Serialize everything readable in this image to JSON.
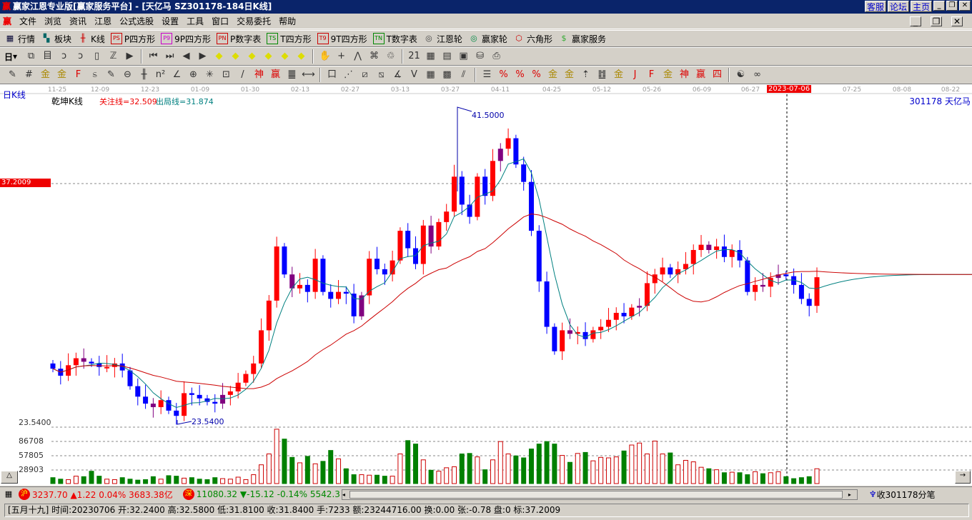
{
  "titlebar": {
    "logo": "赢",
    "title": "赢家江恩专业版[赢家服务平台] - [天亿马  SZ301178-184日K线]",
    "buttons": [
      "客服",
      "论坛",
      "主页"
    ]
  },
  "menu": [
    "文件",
    "浏览",
    "资讯",
    "江恩",
    "公式选股",
    "设置",
    "工具",
    "窗口",
    "交易委托",
    "帮助"
  ],
  "toolbar1": [
    {
      "icon": "table-icon",
      "g": "▦",
      "label": "行情"
    },
    {
      "icon": "blocks-icon",
      "g": "▚",
      "label": "板块"
    },
    {
      "icon": "candle-icon",
      "g": "╫",
      "label": "K线"
    },
    {
      "icon": "ps-icon",
      "g": "PS",
      "label": "P四方形"
    },
    {
      "icon": "p9-icon",
      "g": "P9",
      "label": "9P四方形"
    },
    {
      "icon": "pn-icon",
      "g": "PN",
      "label": "P数字表"
    },
    {
      "icon": "ts-icon",
      "g": "TS",
      "label": "T四方形"
    },
    {
      "icon": "t9-icon",
      "g": "T9",
      "label": "9T四方形"
    },
    {
      "icon": "tn-icon",
      "g": "TN",
      "label": "T数字表"
    },
    {
      "icon": "wheel-icon",
      "g": "◎",
      "label": "江恩轮"
    },
    {
      "icon": "big-wheel-icon",
      "g": "◎",
      "label": "赢家轮"
    },
    {
      "icon": "hexagon-icon",
      "g": "⬡",
      "label": "六角形"
    },
    {
      "icon": "dollar-icon",
      "g": "$",
      "label": "赢家服务"
    }
  ],
  "toolbar2": {
    "period": "日",
    "icons": [
      [
        "draw-icon",
        "⧉"
      ],
      [
        "notes-icon",
        "目"
      ],
      [
        "step3-icon",
        "ↄ"
      ],
      [
        "step9-icon",
        "ↄ"
      ],
      [
        "candle-type-icon",
        "▯"
      ],
      [
        "formula-icon",
        "ℤ"
      ],
      [
        "flag-icon",
        "▶"
      ],
      [
        "first-icon",
        "⏮"
      ],
      [
        "last-icon",
        "⏭"
      ],
      [
        "left-icon",
        "◀"
      ],
      [
        "right-icon",
        "▶"
      ],
      [
        "arrow-left-icon",
        "◆"
      ],
      [
        "arrow-right-icon",
        "◆"
      ],
      [
        "zoom-h-icon",
        "◆"
      ],
      [
        "zoom-in-icon",
        "◆"
      ],
      [
        "zoom-out-icon",
        "◆"
      ],
      [
        "zoom-v-icon",
        "◆"
      ],
      [
        "hand-icon",
        "✋"
      ],
      [
        "cross-icon",
        "+"
      ],
      [
        "line-icon",
        "⋀"
      ],
      [
        "pattern-icon",
        "⌘"
      ],
      [
        "recycle-icon",
        "♲"
      ],
      [
        "calendar-icon",
        "21"
      ],
      [
        "calculator-icon",
        "▦"
      ],
      [
        "doc-icon",
        "▤"
      ],
      [
        "save-icon",
        "▣"
      ],
      [
        "network-icon",
        "⛁"
      ],
      [
        "terminal-icon",
        "⎙"
      ]
    ]
  },
  "toolbar3": {
    "icons": [
      [
        "pen-icon",
        "✎"
      ],
      [
        "grid-icon",
        "#"
      ],
      [
        "gold1-icon",
        "金"
      ],
      [
        "gold2-icon",
        "金"
      ],
      [
        "f-icon",
        "F"
      ],
      [
        "spiral-icon",
        "ಽ"
      ],
      [
        "pen2-icon",
        "✎"
      ],
      [
        "circle-icon",
        "⊖"
      ],
      [
        "bars-icon",
        "╫"
      ],
      [
        "n2-icon",
        "n²"
      ],
      [
        "angle-icon",
        "∠"
      ],
      [
        "target-icon",
        "⊕"
      ],
      [
        "star-icon",
        "✳"
      ],
      [
        "square-icon",
        "⊡"
      ],
      [
        "lines-icon",
        "/"
      ],
      [
        "shen-icon",
        "神"
      ],
      [
        "ying-icon",
        "赢"
      ],
      [
        "box-icon",
        "䷀"
      ],
      [
        "measure-icon",
        "⟷"
      ],
      [
        "rect-icon",
        "口"
      ],
      [
        "fan-icon",
        "⋰"
      ],
      [
        "box2-icon",
        "⧄"
      ],
      [
        "box3-icon",
        "⧅"
      ],
      [
        "angle2-icon",
        "∡"
      ],
      [
        "v-icon",
        "V"
      ],
      [
        "grid2-icon",
        "▦"
      ],
      [
        "grid3-icon",
        "▩"
      ],
      [
        "parallel-icon",
        "⫽"
      ],
      [
        "list-icon",
        "☰"
      ],
      [
        "pct1-icon",
        "%"
      ],
      [
        "pct2-icon",
        "%"
      ],
      [
        "pct3-icon",
        "%"
      ],
      [
        "gold3-icon",
        "金"
      ],
      [
        "gold4-icon",
        "金"
      ],
      [
        "arrow-up-icon",
        "⇡"
      ],
      [
        "ab-icon",
        "䷂"
      ],
      [
        "gold5-icon",
        "金"
      ],
      [
        "j-icon",
        "J"
      ],
      [
        "f2-icon",
        "F"
      ],
      [
        "gold6-icon",
        "金"
      ],
      [
        "shen2-icon",
        "神"
      ],
      [
        "ying2-icon",
        "赢"
      ],
      [
        "four-icon",
        "四"
      ],
      [
        "taiji-icon",
        "☯"
      ],
      [
        "infinity-icon",
        "∞"
      ]
    ]
  },
  "chart": {
    "period_label": "日K线",
    "indicator": "乾坤K线",
    "focus_line": "关注线=32.509",
    "exit_line": "出局线=31.874",
    "stock": "301178  天亿马",
    "cursor_date": "2023-07-06",
    "cursor_price": "37.2009",
    "high_label": "41.5000",
    "low_label": "23.5400",
    "price_axis_low": "23.5400",
    "volume_ticks": [
      "86708",
      "57805",
      "28903"
    ],
    "colors": {
      "up": "#ff0000",
      "down": "#0000ff",
      "ma_short": "#008080",
      "ma_long": "#cc0000",
      "vol_up": "#cc0000",
      "vol_down": "#008000"
    }
  },
  "chart_data": {
    "type": "candlestick",
    "date_ticks": [
      "11-25",
      "12-09",
      "12-23",
      "01-09",
      "01-30",
      "02-13",
      "02-27",
      "03-13",
      "03-27",
      "04-11",
      "04-25",
      "05-12",
      "05-26",
      "06-09",
      "06-27",
      "2023-07-06",
      "07-25",
      "08-08",
      "08-22"
    ],
    "price_range": [
      23.54,
      41.5
    ],
    "close": [
      26.6,
      26.2,
      26.8,
      27.2,
      27.0,
      26.9,
      26.7,
      26.7,
      26.9,
      26.5,
      25.6,
      25.0,
      24.6,
      24.4,
      24.8,
      24.2,
      23.9,
      25.2,
      25.1,
      24.9,
      24.7,
      24.6,
      25.1,
      25.3,
      25.8,
      26.3,
      26.9,
      28.8,
      30.5,
      33.6,
      32.0,
      31.2,
      31.4,
      31.0,
      32.9,
      31.0,
      30.6,
      31.0,
      30.9,
      29.6,
      30.8,
      32.9,
      32.3,
      32.0,
      32.8,
      34.5,
      33.5,
      32.6,
      34.8,
      33.6,
      35.0,
      35.6,
      37.6,
      36.0,
      35.3,
      37.6,
      36.5,
      38.5,
      39.2,
      39.8,
      38.3,
      37.3,
      34.5,
      31.6,
      29.0,
      27.6,
      28.8,
      28.6,
      28.7,
      28.3,
      28.8,
      29.0,
      29.4,
      29.8,
      29.6,
      30.1,
      30.2,
      31.5,
      32.0,
      32.4,
      32.0,
      32.3,
      32.6,
      33.4,
      33.7,
      33.4,
      33.6,
      33.0,
      33.4,
      32.8,
      31.0,
      31.4,
      31.3,
      31.8,
      32.0,
      31.9,
      31.4,
      30.6,
      30.2,
      31.84
    ],
    "volume": [
      12000,
      9000,
      8000,
      15000,
      14000,
      25000,
      15000,
      9000,
      8000,
      12000,
      9000,
      7000,
      8000,
      14000,
      9000,
      16000,
      15000,
      11000,
      12000,
      9000,
      8000,
      12000,
      10000,
      9000,
      13000,
      8000,
      18000,
      38000,
      60000,
      110000,
      90000,
      53000,
      42000,
      55000,
      40000,
      45000,
      67000,
      50000,
      30000,
      18000,
      18000,
      17000,
      17000,
      15000,
      15000,
      60000,
      87000,
      80000,
      48000,
      27000,
      25000,
      32000,
      34000,
      60000,
      61000,
      54000,
      28000,
      48000,
      85000,
      60000,
      56000,
      52000,
      70000,
      80000,
      85000,
      80000,
      57000,
      43000,
      61000,
      63000,
      46000,
      53000,
      52000,
      54000,
      66000,
      78000,
      82000,
      60000,
      86000,
      60000,
      62000,
      38000,
      47000,
      44000,
      33000,
      30000,
      28000,
      22000,
      23000,
      22000,
      18000,
      24000,
      20000,
      22000,
      24000,
      14000,
      10000,
      12000,
      14000,
      30000
    ],
    "ma_tail": 32.0
  },
  "status": {
    "sh_label": "沪",
    "sh": "3237.70",
    "sh_change": "▲1.22 0.04%",
    "sh_amount": "3683.38亿",
    "sz_label": "深",
    "sz": "11080.32",
    "sz_change": "▼-15.12 -0.14%",
    "sz_amount": "5542.3",
    "receive": "收301178分笔"
  },
  "info": "[五月十九] 时间:20230706 开:32.2400 高:32.5800 低:31.8100 收:31.8400 手:7233 额:23244716.00 换:0.00 张:-0.78 盘:0 标:37.2009"
}
